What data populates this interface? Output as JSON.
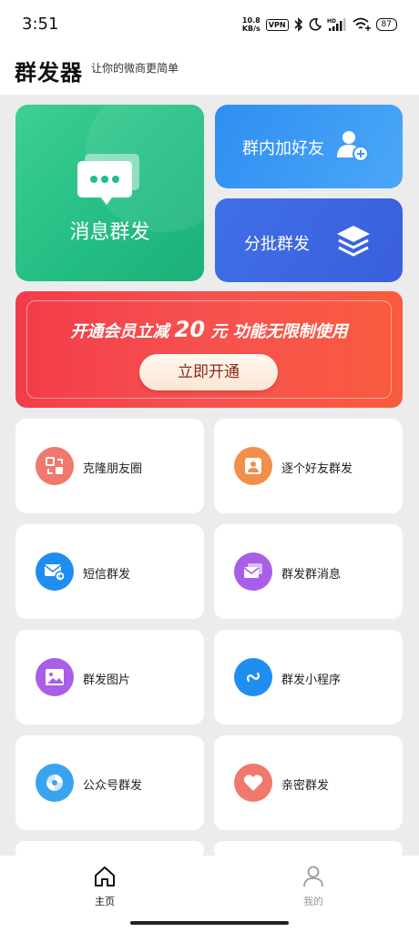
{
  "status": {
    "time": "3:51",
    "net_speed_value": "10.8",
    "net_speed_unit": "KB/s",
    "vpn": "VPN",
    "hd": "HD",
    "battery": "87"
  },
  "header": {
    "title": "群发器",
    "subtitle": "让你的微商更简单"
  },
  "feature_cards": {
    "message_broadcast": "消息群发",
    "group_add_friends": "群内加好友",
    "batch_broadcast": "分批群发"
  },
  "promo": {
    "text_prefix": "开通会员立减",
    "amount": "20",
    "text_suffix": "元  功能无限制使用",
    "button": "立即开通"
  },
  "tiles": [
    {
      "label": "克隆朋友圈",
      "icon": "clone-moments-icon",
      "color": "#f0786c"
    },
    {
      "label": "逐个好友群发",
      "icon": "single-friend-icon",
      "color": "#f0904a"
    },
    {
      "label": "短信群发",
      "icon": "sms-icon",
      "color": "#1f8ef0"
    },
    {
      "label": "群发群消息",
      "icon": "group-message-icon",
      "color": "#a95ee8"
    },
    {
      "label": "群发图片",
      "icon": "image-icon",
      "color": "#a95ee8"
    },
    {
      "label": "群发小程序",
      "icon": "mini-program-icon",
      "color": "#1f8ef0"
    },
    {
      "label": "公众号群发",
      "icon": "official-account-icon",
      "color": "#3aa3f0"
    },
    {
      "label": "亲密群发",
      "icon": "heart-icon",
      "color": "#f0786c"
    }
  ],
  "bottom_nav": {
    "home": "主页",
    "mine": "我的"
  },
  "colors": {
    "green_card": "#22bd83",
    "blue_card": "#2f8ef2",
    "promo_red": "#f33c4a"
  }
}
